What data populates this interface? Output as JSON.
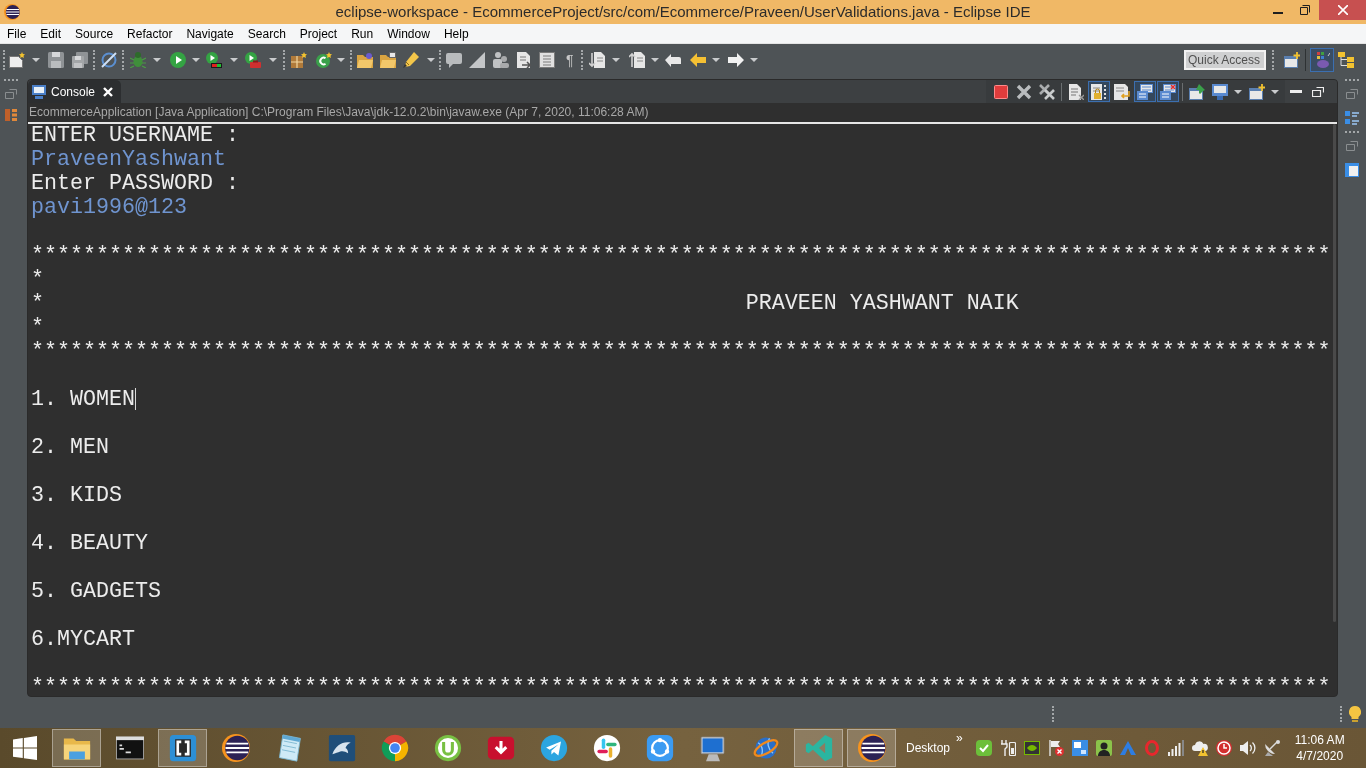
{
  "window": {
    "title": "eclipse-workspace - EcommerceProject/src/com/Ecommerce/Praveen/UserValidations.java - Eclipse IDE"
  },
  "menu": [
    "File",
    "Edit",
    "Source",
    "Refactor",
    "Navigate",
    "Search",
    "Project",
    "Run",
    "Window",
    "Help"
  ],
  "toolbar": {
    "pilcrow": "¶",
    "quick_access": {
      "placeholder": "Quick Access"
    },
    "perspectives": [
      {
        "kind": "grid",
        "selected": true
      },
      {
        "kind": "tree",
        "selected": false
      }
    ]
  },
  "console": {
    "tab": {
      "label": "Console",
      "selected": true
    },
    "toggles": {
      "scroll_lock": true,
      "show_on_output": true,
      "show_on_error": true
    },
    "description": "EcommerceApplication [Java Application] C:\\Program Files\\Java\\jdk-12.0.2\\bin\\javaw.exe (Apr 7, 2020, 11:06:28 AM)",
    "lines": [
      {
        "kind": "output",
        "text": "ENTER USERNAME :",
        "caret": false
      },
      {
        "kind": "input",
        "text": "PraveenYashwant",
        "caret": false
      },
      {
        "kind": "output",
        "text": "Enter PASSWORD :",
        "caret": false
      },
      {
        "kind": "input",
        "text": "pavi1996@123",
        "caret": false
      },
      {
        "kind": "blank"
      },
      {
        "kind": "output",
        "text": "****************************************************************************************************\n*\n*                                                      PRAVEEN YASHWANT NAIK\n*\n****************************************************************************************************",
        "caret": false
      },
      {
        "kind": "blank"
      },
      {
        "kind": "output",
        "text": "1. WOMEN",
        "caret": true
      },
      {
        "kind": "blank"
      },
      {
        "kind": "output",
        "text": "2. MEN",
        "caret": false
      },
      {
        "kind": "blank"
      },
      {
        "kind": "output",
        "text": "3. KIDS",
        "caret": false
      },
      {
        "kind": "blank"
      },
      {
        "kind": "output",
        "text": "4. BEAUTY",
        "caret": false
      },
      {
        "kind": "blank"
      },
      {
        "kind": "output",
        "text": "5. GADGETS",
        "caret": false
      },
      {
        "kind": "blank"
      },
      {
        "kind": "output",
        "text": "6.MYCART",
        "caret": false
      },
      {
        "kind": "blank"
      },
      {
        "kind": "output",
        "text": "****************************************************************************************************",
        "caret": false
      }
    ]
  },
  "taskbar": {
    "apps": [
      {
        "kind": "folder",
        "open": true
      },
      {
        "kind": "terminal",
        "open": false
      },
      {
        "kind": "brackets",
        "open": true
      },
      {
        "kind": "orb",
        "open": false
      },
      {
        "kind": "notepad",
        "open": false
      },
      {
        "kind": "dolphin",
        "open": false
      },
      {
        "kind": "wheel",
        "open": false
      },
      {
        "kind": "ringu",
        "open": false
      },
      {
        "kind": "download",
        "open": false
      },
      {
        "kind": "plane",
        "open": false
      },
      {
        "kind": "pinwheel",
        "open": false
      },
      {
        "kind": "share",
        "open": false
      },
      {
        "kind": "monitor",
        "open": false
      },
      {
        "kind": "globe",
        "open": false
      },
      {
        "kind": "ribbon",
        "open": true
      },
      {
        "kind": "orb",
        "open": true
      }
    ],
    "toolbar_label": "Desktop",
    "chevron": "»",
    "clock": {
      "time": "11:06 AM",
      "date": "4/7/2020"
    }
  }
}
